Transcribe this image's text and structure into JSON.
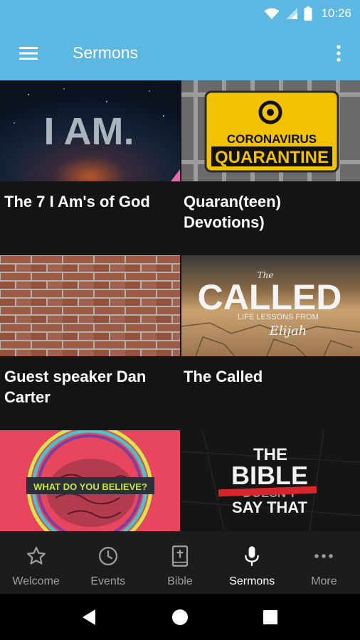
{
  "status_bar": {
    "time": "10:26"
  },
  "app_bar": {
    "title": "Sermons"
  },
  "sermons": [
    {
      "title": "The 7 I Am's of God",
      "thumb_text": "I AM."
    },
    {
      "title": "Quaran(teen) Devotions)",
      "thumb_text_1": "CORONAVIRUS",
      "thumb_text_2": "QUARANTINE"
    },
    {
      "title": "Guest speaker Dan Carter"
    },
    {
      "title": "The Called",
      "thumb_text_1": "The",
      "thumb_text_2": "CALLED",
      "thumb_text_3": "LIFE LESSONS FROM",
      "thumb_text_4": "Elijah"
    },
    {
      "title": "",
      "thumb_text": "WHAT DO YOU BELIEVE?"
    },
    {
      "title": "",
      "thumb_text_1": "THE",
      "thumb_text_2": "BIBLE",
      "thumb_text_3": "DOESN'T",
      "thumb_text_4": "SAY THAT"
    }
  ],
  "bottom_nav": [
    {
      "label": "Welcome",
      "icon": "star-icon"
    },
    {
      "label": "Events",
      "icon": "clock-icon"
    },
    {
      "label": "Bible",
      "icon": "bible-icon"
    },
    {
      "label": "Sermons",
      "icon": "microphone-icon",
      "active": true
    },
    {
      "label": "More",
      "icon": "more-dots-icon"
    }
  ],
  "colors": {
    "app_bar": "#5cb8e3",
    "background": "#121212",
    "nav_bar": "#1c1c1c",
    "nav_inactive": "#9e9e9e",
    "nav_active": "#ffffff"
  }
}
